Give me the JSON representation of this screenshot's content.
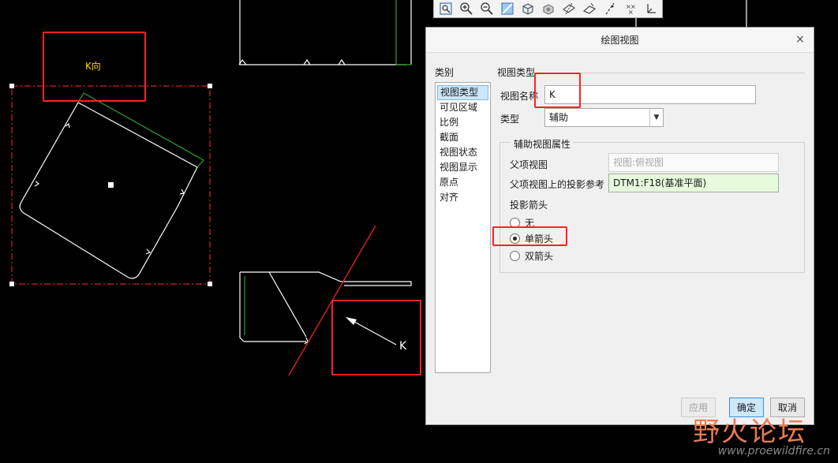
{
  "colors": {
    "canvas": "#000000",
    "geometry": "#ffffff",
    "green_edge": "#2ea02e",
    "red_datum": "#e02020",
    "highlight": "#ff2222",
    "yellow_label": "#ffd400"
  },
  "canvas": {
    "view_label": "K向",
    "arrow_label": "K"
  },
  "toolbar": {
    "icons": [
      "zoom-window-icon",
      "zoom-in-icon",
      "zoom-out-icon",
      "repaint-icon",
      "display-style-icon",
      "saved-orientations-icon",
      "datum-display-icon",
      "plane-display-icon",
      "axis-display-icon",
      "point-display-icon",
      "csys-display-icon"
    ]
  },
  "dialog": {
    "title": "绘图视图",
    "close": "×",
    "categories_label": "类别",
    "categories": [
      "视图类型",
      "可见区域",
      "比例",
      "截面",
      "视图状态",
      "视图显示",
      "原点",
      "对齐"
    ],
    "selected_category": "视图类型",
    "section_title": "视图类型",
    "view_name_label": "视图名称",
    "view_name_value": "K",
    "type_label": "类型",
    "type_value": "辅助",
    "aux_group_title": "辅助视图属性",
    "parent_view_label": "父项视图",
    "parent_view_value": "视图:俯视图",
    "projection_ref_label": "父项视图上的投影参考",
    "projection_ref_value": "DTM1:F18(基准平面)",
    "arrow_label": "投影箭头",
    "arrow_options": [
      "无",
      "单箭头",
      "双箭头"
    ],
    "arrow_selected": "单箭头",
    "buttons": {
      "apply": "应用",
      "ok": "确定",
      "cancel": "取消"
    }
  },
  "watermark": {
    "main": "野火论坛",
    "url": "www.proewildfire.cn"
  }
}
